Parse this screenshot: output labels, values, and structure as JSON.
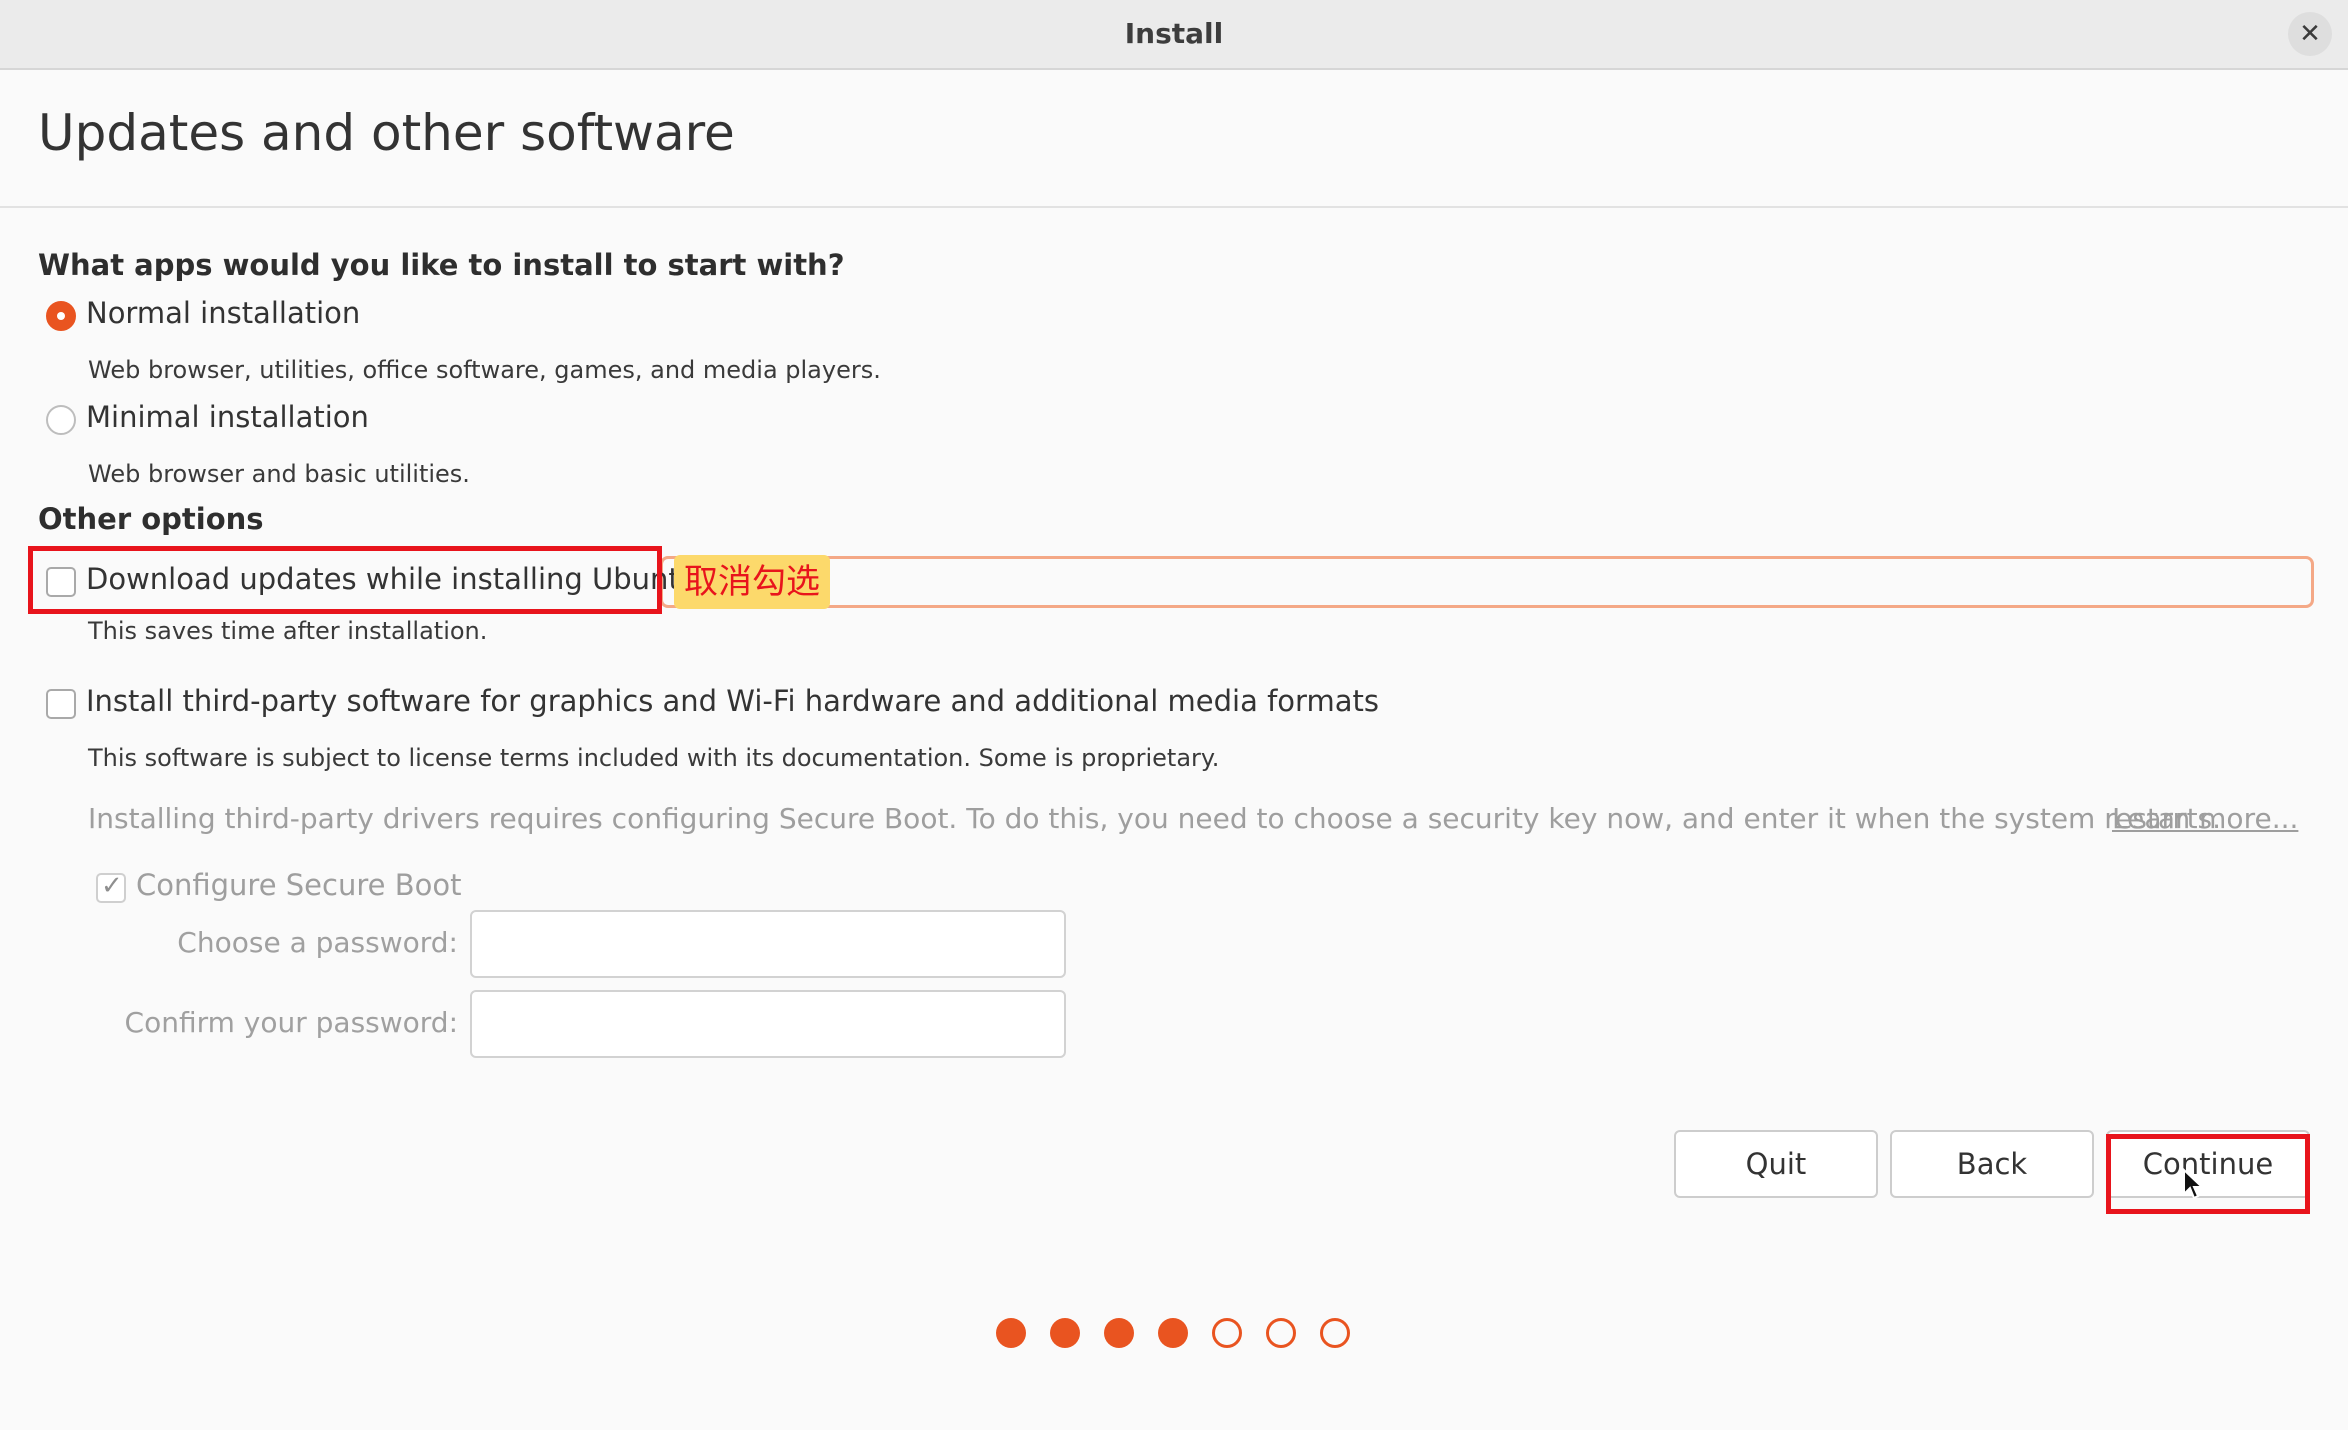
{
  "window": {
    "title": "Install",
    "close_icon": "close-icon"
  },
  "page": {
    "title": "Updates and other software"
  },
  "apps_section": {
    "heading": "What apps would you like to install to start with?",
    "normal": {
      "label": "Normal installation",
      "description": "Web browser, utilities, office software, games, and media players.",
      "selected": true
    },
    "minimal": {
      "label": "Minimal installation",
      "description": "Web browser and basic utilities.",
      "selected": false
    }
  },
  "other_options": {
    "heading": "Other options",
    "download_updates": {
      "label": "Download updates while installing Ubuntu",
      "description": "This saves time after installation.",
      "checked": false
    },
    "third_party": {
      "label": "Install third-party software for graphics and Wi-Fi hardware and additional media formats",
      "description": "This software is subject to license terms included with its documentation. Some is proprietary.",
      "checked": false
    },
    "secure_boot_note": "Installing third-party drivers requires configuring Secure Boot. To do this, you need to choose a security key now, and enter it when the system restarts.",
    "learn_more": "Learn more...",
    "configure_secure_boot": {
      "label": "Configure Secure Boot",
      "checked": true,
      "disabled": true
    },
    "password_label": "Choose a password:",
    "confirm_label": "Confirm your password:",
    "password_value": "",
    "confirm_value": ""
  },
  "annotation": {
    "hint_text": "取消勾选",
    "highlight_color": "#e8141c"
  },
  "buttons": {
    "quit": "Quit",
    "back": "Back",
    "continue": "Continue"
  },
  "progress": {
    "total_steps": 7,
    "completed_steps": 4,
    "accent": "#e95420"
  }
}
